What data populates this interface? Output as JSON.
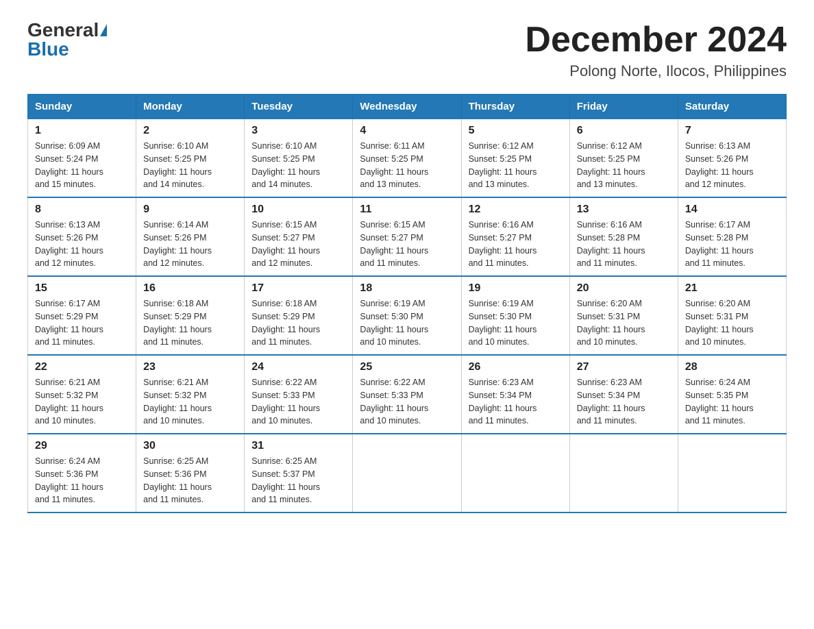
{
  "header": {
    "logo_general": "General",
    "logo_blue": "Blue",
    "month_title": "December 2024",
    "location": "Polong Norte, Ilocos, Philippines"
  },
  "days_of_week": [
    "Sunday",
    "Monday",
    "Tuesday",
    "Wednesday",
    "Thursday",
    "Friday",
    "Saturday"
  ],
  "weeks": [
    [
      {
        "day": "1",
        "sunrise": "6:09 AM",
        "sunset": "5:24 PM",
        "daylight": "11 hours and 15 minutes."
      },
      {
        "day": "2",
        "sunrise": "6:10 AM",
        "sunset": "5:25 PM",
        "daylight": "11 hours and 14 minutes."
      },
      {
        "day": "3",
        "sunrise": "6:10 AM",
        "sunset": "5:25 PM",
        "daylight": "11 hours and 14 minutes."
      },
      {
        "day": "4",
        "sunrise": "6:11 AM",
        "sunset": "5:25 PM",
        "daylight": "11 hours and 13 minutes."
      },
      {
        "day": "5",
        "sunrise": "6:12 AM",
        "sunset": "5:25 PM",
        "daylight": "11 hours and 13 minutes."
      },
      {
        "day": "6",
        "sunrise": "6:12 AM",
        "sunset": "5:25 PM",
        "daylight": "11 hours and 13 minutes."
      },
      {
        "day": "7",
        "sunrise": "6:13 AM",
        "sunset": "5:26 PM",
        "daylight": "11 hours and 12 minutes."
      }
    ],
    [
      {
        "day": "8",
        "sunrise": "6:13 AM",
        "sunset": "5:26 PM",
        "daylight": "11 hours and 12 minutes."
      },
      {
        "day": "9",
        "sunrise": "6:14 AM",
        "sunset": "5:26 PM",
        "daylight": "11 hours and 12 minutes."
      },
      {
        "day": "10",
        "sunrise": "6:15 AM",
        "sunset": "5:27 PM",
        "daylight": "11 hours and 12 minutes."
      },
      {
        "day": "11",
        "sunrise": "6:15 AM",
        "sunset": "5:27 PM",
        "daylight": "11 hours and 11 minutes."
      },
      {
        "day": "12",
        "sunrise": "6:16 AM",
        "sunset": "5:27 PM",
        "daylight": "11 hours and 11 minutes."
      },
      {
        "day": "13",
        "sunrise": "6:16 AM",
        "sunset": "5:28 PM",
        "daylight": "11 hours and 11 minutes."
      },
      {
        "day": "14",
        "sunrise": "6:17 AM",
        "sunset": "5:28 PM",
        "daylight": "11 hours and 11 minutes."
      }
    ],
    [
      {
        "day": "15",
        "sunrise": "6:17 AM",
        "sunset": "5:29 PM",
        "daylight": "11 hours and 11 minutes."
      },
      {
        "day": "16",
        "sunrise": "6:18 AM",
        "sunset": "5:29 PM",
        "daylight": "11 hours and 11 minutes."
      },
      {
        "day": "17",
        "sunrise": "6:18 AM",
        "sunset": "5:29 PM",
        "daylight": "11 hours and 11 minutes."
      },
      {
        "day": "18",
        "sunrise": "6:19 AM",
        "sunset": "5:30 PM",
        "daylight": "11 hours and 10 minutes."
      },
      {
        "day": "19",
        "sunrise": "6:19 AM",
        "sunset": "5:30 PM",
        "daylight": "11 hours and 10 minutes."
      },
      {
        "day": "20",
        "sunrise": "6:20 AM",
        "sunset": "5:31 PM",
        "daylight": "11 hours and 10 minutes."
      },
      {
        "day": "21",
        "sunrise": "6:20 AM",
        "sunset": "5:31 PM",
        "daylight": "11 hours and 10 minutes."
      }
    ],
    [
      {
        "day": "22",
        "sunrise": "6:21 AM",
        "sunset": "5:32 PM",
        "daylight": "11 hours and 10 minutes."
      },
      {
        "day": "23",
        "sunrise": "6:21 AM",
        "sunset": "5:32 PM",
        "daylight": "11 hours and 10 minutes."
      },
      {
        "day": "24",
        "sunrise": "6:22 AM",
        "sunset": "5:33 PM",
        "daylight": "11 hours and 10 minutes."
      },
      {
        "day": "25",
        "sunrise": "6:22 AM",
        "sunset": "5:33 PM",
        "daylight": "11 hours and 10 minutes."
      },
      {
        "day": "26",
        "sunrise": "6:23 AM",
        "sunset": "5:34 PM",
        "daylight": "11 hours and 11 minutes."
      },
      {
        "day": "27",
        "sunrise": "6:23 AM",
        "sunset": "5:34 PM",
        "daylight": "11 hours and 11 minutes."
      },
      {
        "day": "28",
        "sunrise": "6:24 AM",
        "sunset": "5:35 PM",
        "daylight": "11 hours and 11 minutes."
      }
    ],
    [
      {
        "day": "29",
        "sunrise": "6:24 AM",
        "sunset": "5:36 PM",
        "daylight": "11 hours and 11 minutes."
      },
      {
        "day": "30",
        "sunrise": "6:25 AM",
        "sunset": "5:36 PM",
        "daylight": "11 hours and 11 minutes."
      },
      {
        "day": "31",
        "sunrise": "6:25 AM",
        "sunset": "5:37 PM",
        "daylight": "11 hours and 11 minutes."
      },
      null,
      null,
      null,
      null
    ]
  ],
  "labels": {
    "sunrise": "Sunrise:",
    "sunset": "Sunset:",
    "daylight": "Daylight:"
  }
}
